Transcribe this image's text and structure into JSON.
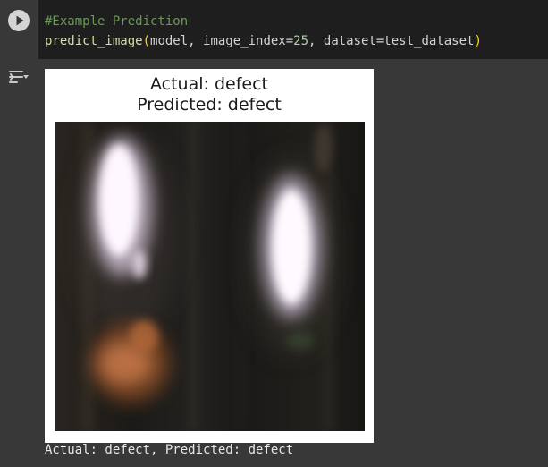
{
  "cell": {
    "comment": "#Example Prediction",
    "code": {
      "fn": "predict_image",
      "open": "(",
      "arg1": "model, image_index=",
      "num": "25",
      "arg2": ", dataset=test_dataset",
      "close": ")"
    }
  },
  "output": {
    "figure_title_line1": "Actual: defect",
    "figure_title_line2": "Predicted: defect",
    "text": "Actual: defect, Predicted: defect"
  },
  "colors": {
    "code_bg": "#1e1e1e",
    "page_bg": "#383838",
    "comment": "#6a9955",
    "function": "#dcdcaa",
    "bracket": "#ffd700"
  },
  "icons": {
    "run": "play-circle-icon",
    "output_toggle": "output-toggle-icon"
  }
}
